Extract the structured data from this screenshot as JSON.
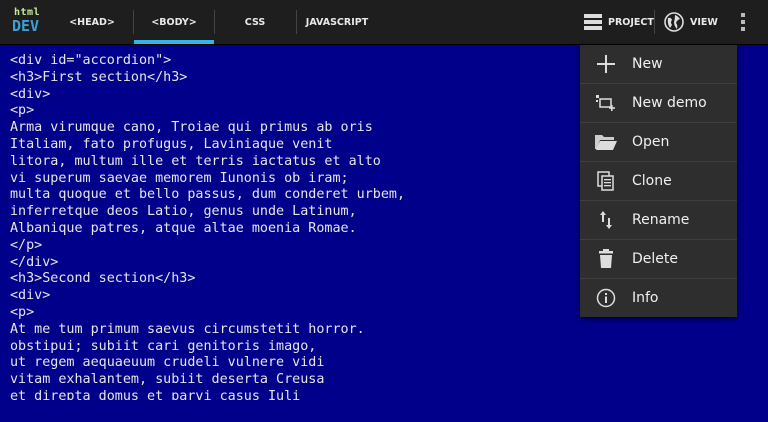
{
  "logo": {
    "line1": "html",
    "line2": "DEV"
  },
  "tabs": [
    {
      "label": "<HEAD>",
      "active": false
    },
    {
      "label": "<BODY>",
      "active": true
    },
    {
      "label": "CSS",
      "active": false
    },
    {
      "label": "JAVASCRIPT",
      "active": false
    }
  ],
  "actions": {
    "project": "PROJECT",
    "view": "VIEW"
  },
  "editor": {
    "code": "<div id=\"accordion\">\n<h3>First section</h3>\n<div>\n<p>\nArma virumque cano, Troiae qui primus ab oris\nItaliam, fato profugus, Laviniaque venit\nlitora, multum ille et terris iactatus et alto\nvi superum saevae memorem Iunonis ob iram;\nmulta quoque et bello passus, dum conderet urbem,\ninferretque deos Latio, genus unde Latinum,\nAlbanique patres, atque altae moenia Romae.\n</p>\n</div>\n<h3>Second section</h3>\n<div>\n<p>\nAt me tum primum saevus circumstetit horror.\nobstipui; subiit cari genitoris imago,\nut regem aequaeuum crudeli vulnere vidi\nvitam exhalantem, subiit deserta Creusa\net direpta domus et parvi casus Iuli"
  },
  "menu": [
    {
      "label": "New",
      "icon": "plus-icon"
    },
    {
      "label": "New demo",
      "icon": "new-demo-icon"
    },
    {
      "label": "Open",
      "icon": "folder-open-icon"
    },
    {
      "label": "Clone",
      "icon": "copy-icon"
    },
    {
      "label": "Rename",
      "icon": "rename-icon"
    },
    {
      "label": "Delete",
      "icon": "trash-icon"
    },
    {
      "label": "Info",
      "icon": "info-icon"
    }
  ],
  "colors": {
    "editor_bg": "#00008b",
    "toolbar_bg": "#1e1e1e",
    "accent": "#33b5e5",
    "menu_bg": "#2e2e2e"
  }
}
